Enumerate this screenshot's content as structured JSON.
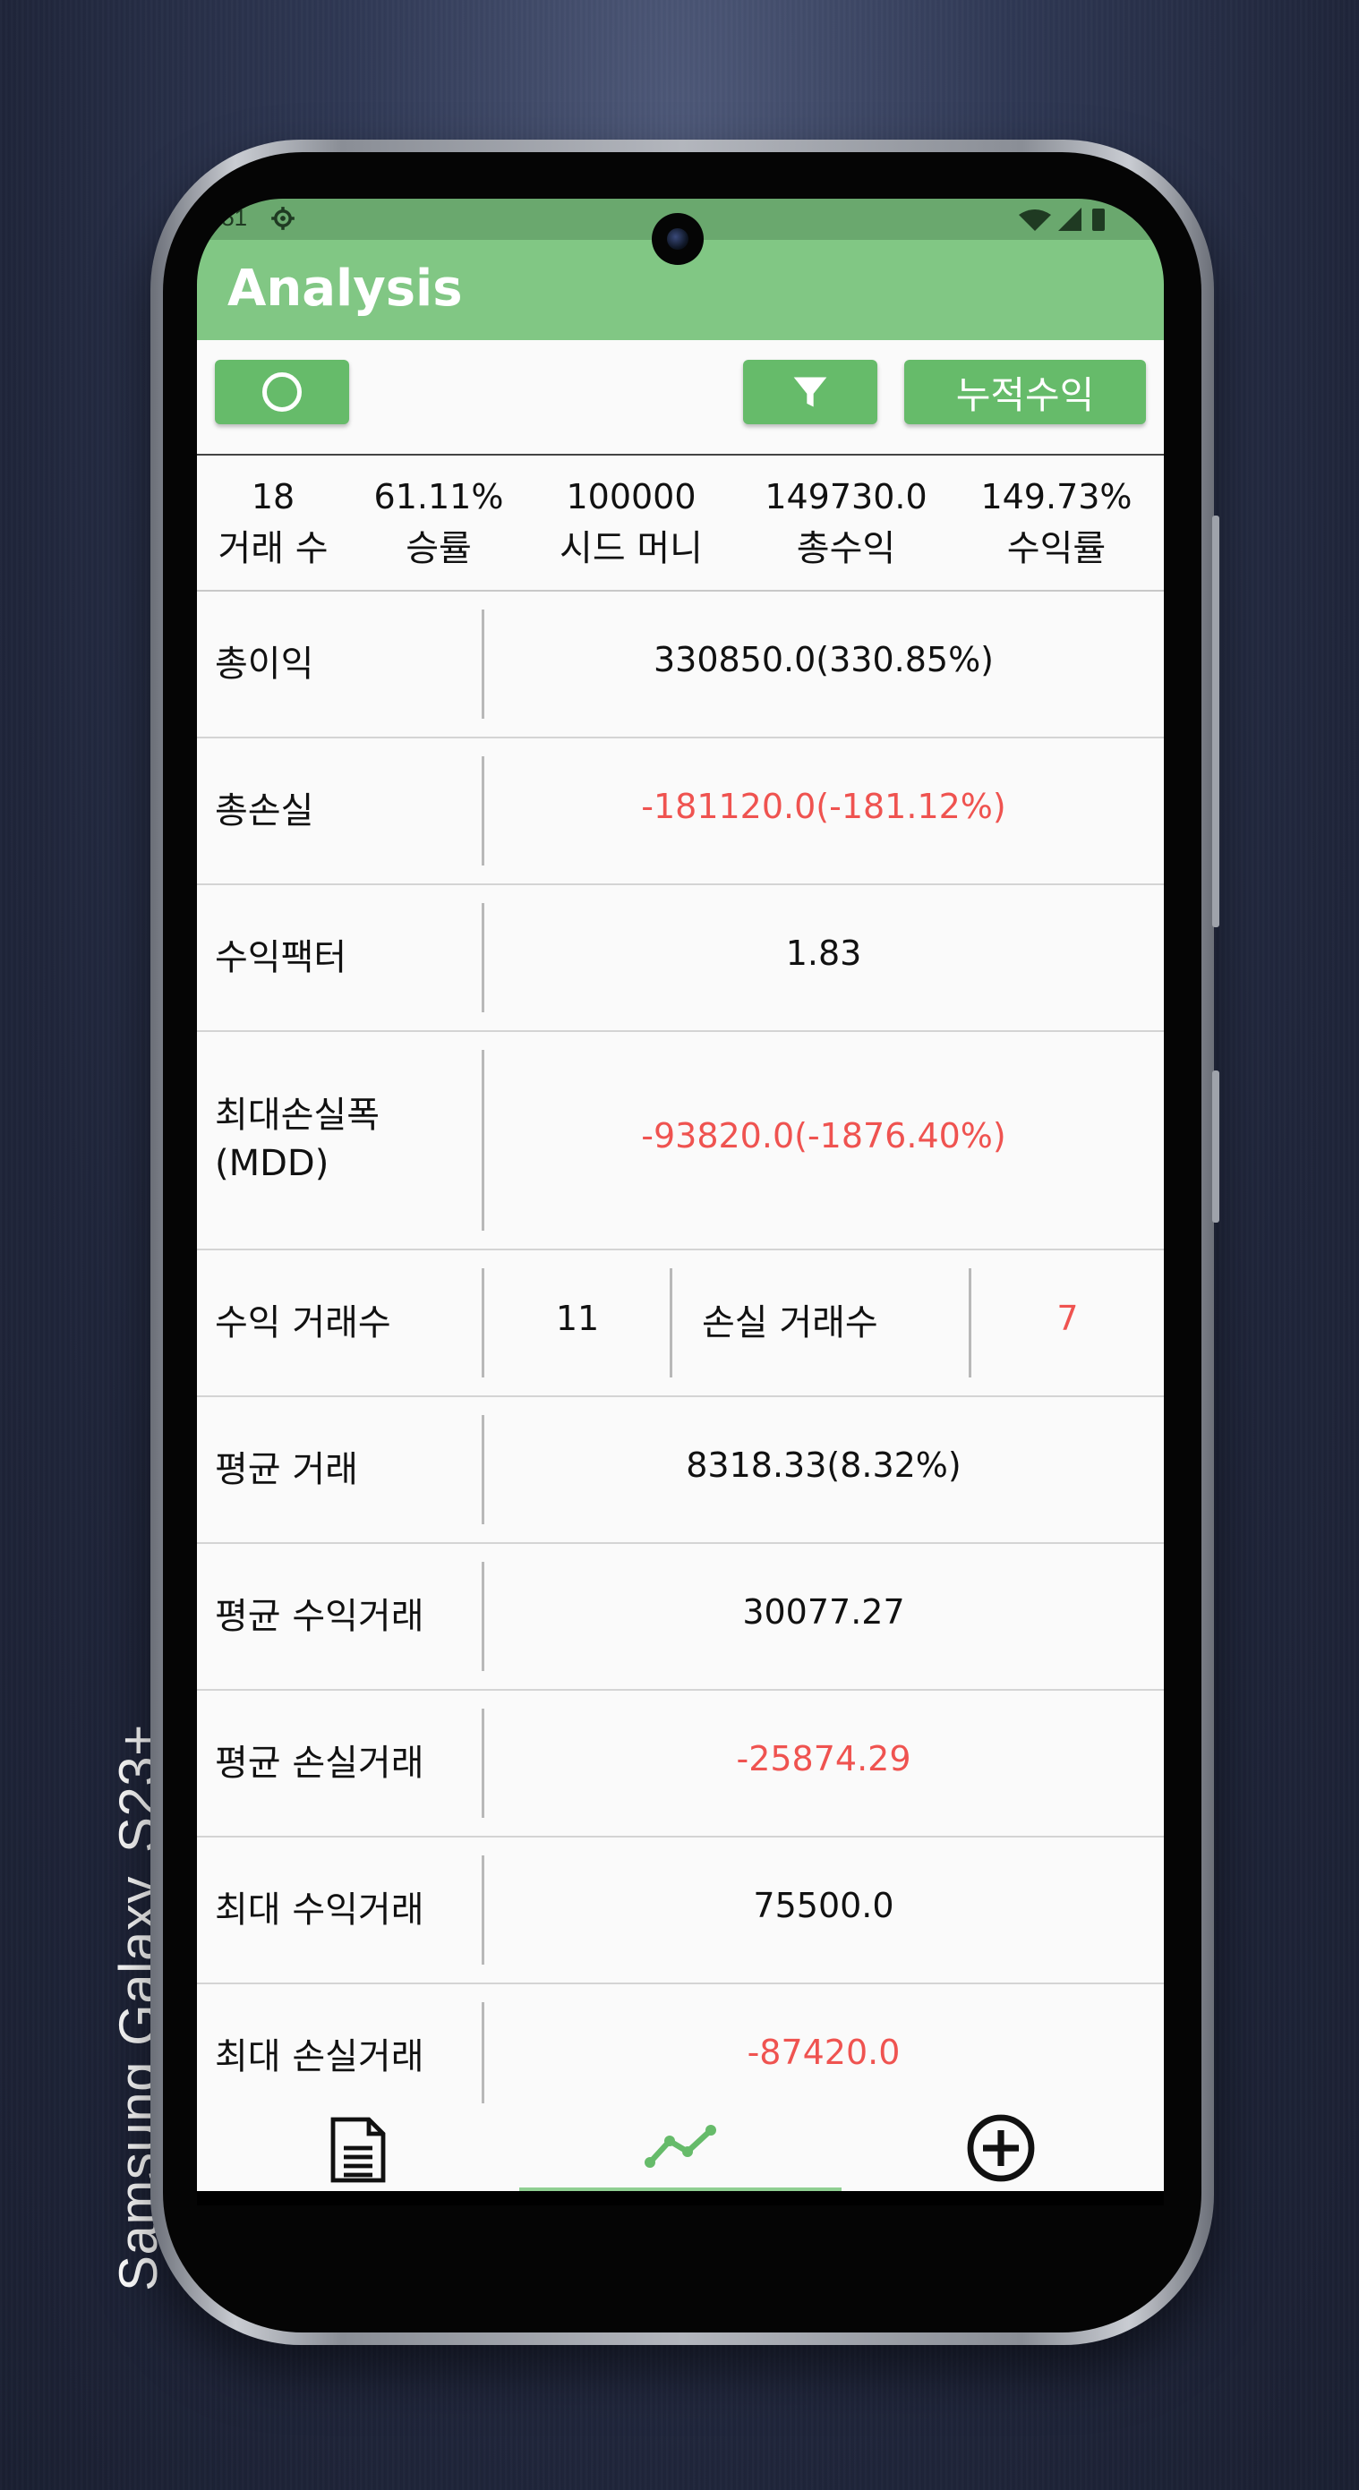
{
  "device": {
    "brand_label": "Samsung Galaxy",
    "model_label": "S23+"
  },
  "status_bar": {
    "time": ":51",
    "icons": [
      "gear-icon",
      "wifi-icon",
      "signal-icon",
      "battery-icon"
    ]
  },
  "app_bar": {
    "title": "Analysis",
    "color": "#81c784"
  },
  "toolbar": {
    "cumulative_label": "누적수익",
    "button_color": "#66bb6a",
    "icons": [
      "circle-icon",
      "filter-icon"
    ]
  },
  "summary": [
    {
      "value": "18",
      "label": "거래 수"
    },
    {
      "value": "61.11%",
      "label": "승률"
    },
    {
      "value": "100000",
      "label": "시드 머니"
    },
    {
      "value": "149730.0",
      "label": "총수익"
    },
    {
      "value": "149.73%",
      "label": "수익률"
    }
  ],
  "stats": {
    "total_profit": {
      "label": "총이익",
      "value": "330850.0(330.85%)"
    },
    "total_loss": {
      "label": "총손실",
      "value": "-181120.0(-181.12%)"
    },
    "profit_factor": {
      "label": "수익팩터",
      "value": "1.83"
    },
    "mdd": {
      "label_line1": "최대손실폭",
      "label_line2": "(MDD)",
      "value": "-93820.0(-1876.40%)"
    },
    "trade_counts": {
      "win_label": "수익 거래수",
      "win_value": "11",
      "loss_label": "손실 거래수",
      "loss_value": "7"
    },
    "avg_trade": {
      "label": "평균 거래",
      "value": "8318.33(8.32%)"
    },
    "avg_win": {
      "label": "평균 수익거래",
      "value": "30077.27"
    },
    "avg_loss": {
      "label": "평균 손실거래",
      "value": "-25874.29"
    },
    "max_win": {
      "label": "최대 수익거래",
      "value": "75500.0"
    },
    "max_loss": {
      "label": "최대 손실거래",
      "value": "-87420.0"
    }
  },
  "colors": {
    "negative": "#ef5350",
    "positive": "#111111"
  },
  "bottom_nav": {
    "items": [
      "document-icon",
      "chart-line-icon",
      "add-circle-icon"
    ],
    "active_index": 1
  }
}
